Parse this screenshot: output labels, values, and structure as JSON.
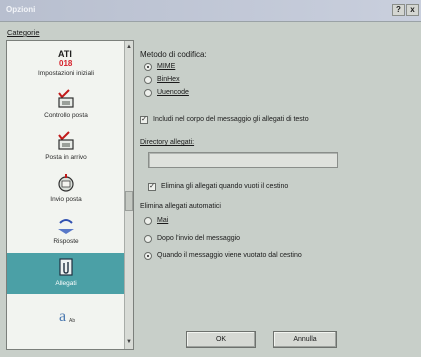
{
  "window": {
    "title": "Opzioni",
    "help_glyph": "?",
    "close_glyph": "x"
  },
  "category": {
    "header": "Categorie",
    "items": [
      {
        "label": "Impostazioni iniziali",
        "icon": "ati-icon"
      },
      {
        "label": "Controllo posta",
        "icon": "mailbox-check-icon"
      },
      {
        "label": "Posta in arrivo",
        "icon": "inbox-icon"
      },
      {
        "label": "Invio posta",
        "icon": "send-mail-icon"
      },
      {
        "label": "Risposte",
        "icon": "reply-icon"
      },
      {
        "label": "Allegati",
        "icon": "attachment-icon"
      },
      {
        "label": "",
        "icon": "font-icon"
      }
    ],
    "selected_index": 5
  },
  "encoding": {
    "title": "Metodo di codifica:",
    "options": [
      "MIME",
      "BinHex",
      "Uuencode"
    ],
    "selected_index": 0
  },
  "include_text": {
    "label": "Includi nel corpo del messaggio gli allegati di testo",
    "checked": true
  },
  "directory": {
    "label": "Directory allegati:",
    "value": ""
  },
  "delete_on_trash": {
    "label": "Elimina gli allegati quando vuoti il cestino",
    "checked": true
  },
  "auto_delete": {
    "title": "Elimina allegati automatici",
    "options": [
      "Mai",
      "Dopo l'invio del messaggio",
      "Quando il messaggio viene vuotato dal cestino"
    ],
    "selected_index": 2
  },
  "buttons": {
    "ok": "OK",
    "cancel": "Annulla"
  },
  "scroll": {
    "up": "▲",
    "down": "▼"
  },
  "colors": {
    "selection": "#4ba0a6",
    "dialog_bg": "#c8cfc9"
  }
}
